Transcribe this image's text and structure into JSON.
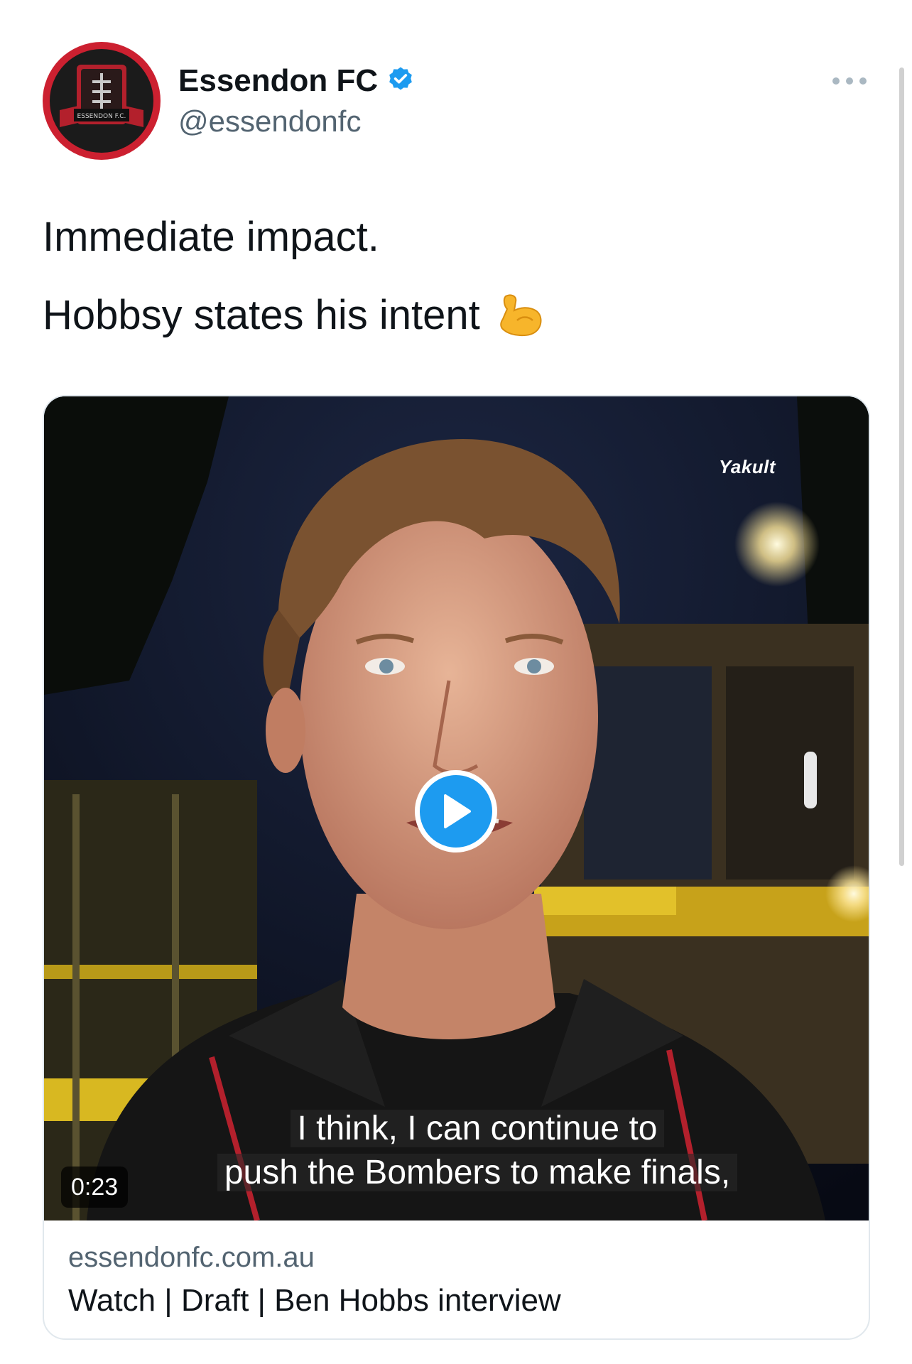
{
  "author": {
    "display_name": "Essendon FC",
    "handle": "@essendonfc",
    "verified": true,
    "avatar_banner_text": "ESSENDON F.C."
  },
  "tweet": {
    "line1": "Immediate impact.",
    "line2": "Hobbsy states his intent",
    "emoji_icon": "flexed-biceps-icon"
  },
  "media": {
    "watermark": "Yakult",
    "duration": "0:23",
    "subtitle_line1": "I think, I can continue to",
    "subtitle_line2": "push the Bombers to make finals,"
  },
  "card": {
    "domain": "essendonfc.com.au",
    "title": "Watch | Draft | Ben Hobbs interview"
  },
  "colors": {
    "accent": "#1d9bf0",
    "brand_red": "#cc2030"
  }
}
